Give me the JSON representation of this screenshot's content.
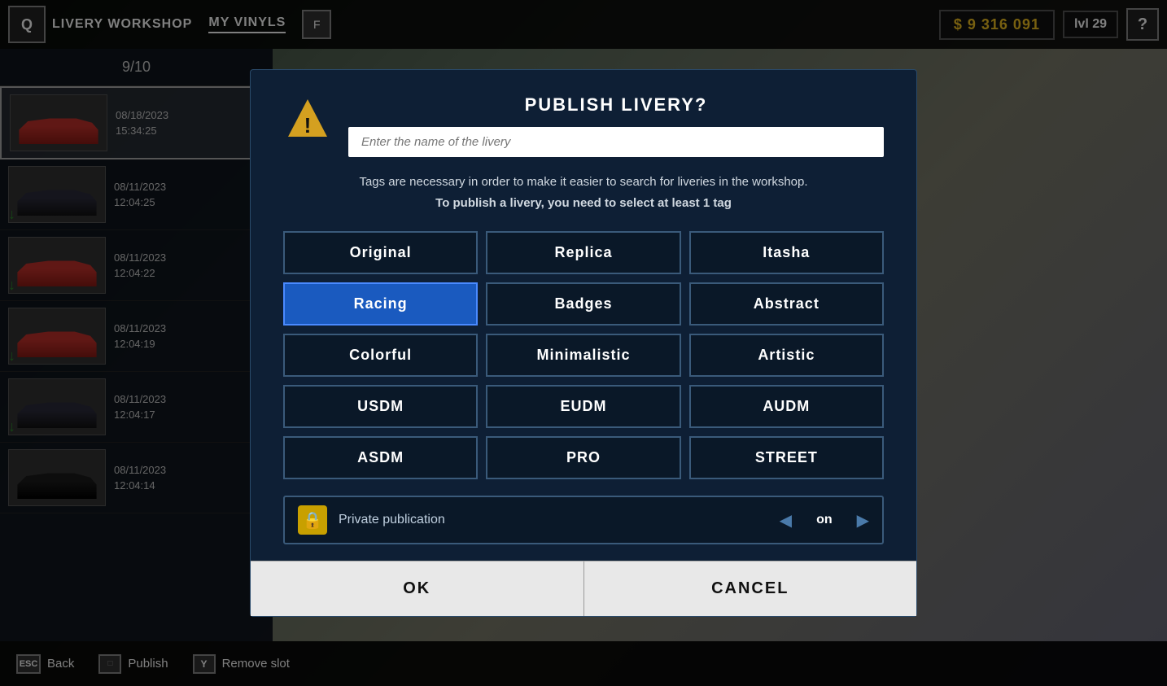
{
  "topbar": {
    "q_key": "Q",
    "livery_workshop": "LIVERY WORKSHOP",
    "my_vinyls": "MY VINYLS",
    "f_key": "F",
    "currency": "$ 9 316 091",
    "level": "lvl 29",
    "help": "?"
  },
  "sidebar": {
    "counter": "9/10",
    "items": [
      {
        "date": "08/18/2023",
        "time": "15:34:25",
        "type": "red",
        "selected": true
      },
      {
        "date": "08/11/2023",
        "time": "12:04:25",
        "type": "dark",
        "selected": false,
        "download": true
      },
      {
        "date": "08/11/2023",
        "time": "12:04:22",
        "type": "red",
        "selected": false,
        "download": true
      },
      {
        "date": "08/11/2023",
        "time": "12:04:19",
        "type": "red",
        "selected": false,
        "download": true
      },
      {
        "date": "08/11/2023",
        "time": "12:04:17",
        "type": "dark",
        "selected": false,
        "download": true
      },
      {
        "date": "08/11/2023",
        "time": "12:04:14",
        "type": "black",
        "selected": false
      }
    ]
  },
  "modal": {
    "title": "PUBLISH LIVERY?",
    "name_placeholder": "Enter the name of the livery",
    "tags_info_line1": "Tags are necessary in order to make it easier to search for liveries in the workshop.",
    "tags_info_line2": "To publish a livery, you need to select at least 1 tag",
    "tags": [
      {
        "label": "Original",
        "selected": false
      },
      {
        "label": "Replica",
        "selected": false
      },
      {
        "label": "Itasha",
        "selected": false
      },
      {
        "label": "Racing",
        "selected": true
      },
      {
        "label": "Badges",
        "selected": false
      },
      {
        "label": "Abstract",
        "selected": false
      },
      {
        "label": "Colorful",
        "selected": false
      },
      {
        "label": "Minimalistic",
        "selected": false
      },
      {
        "label": "Artistic",
        "selected": false
      },
      {
        "label": "USDM",
        "selected": false
      },
      {
        "label": "EUDM",
        "selected": false
      },
      {
        "label": "AUDM",
        "selected": false
      },
      {
        "label": "ASDM",
        "selected": false
      },
      {
        "label": "PRO",
        "selected": false
      },
      {
        "label": "STREET",
        "selected": false
      }
    ],
    "private_label": "Private publication",
    "toggle_value": "on",
    "ok_label": "OK",
    "cancel_label": "CANCEL"
  },
  "bottombar": {
    "esc_key": "ESC",
    "back_label": "Back",
    "publish_label": "Publish",
    "y_key": "Y",
    "remove_slot_label": "Remove slot"
  }
}
